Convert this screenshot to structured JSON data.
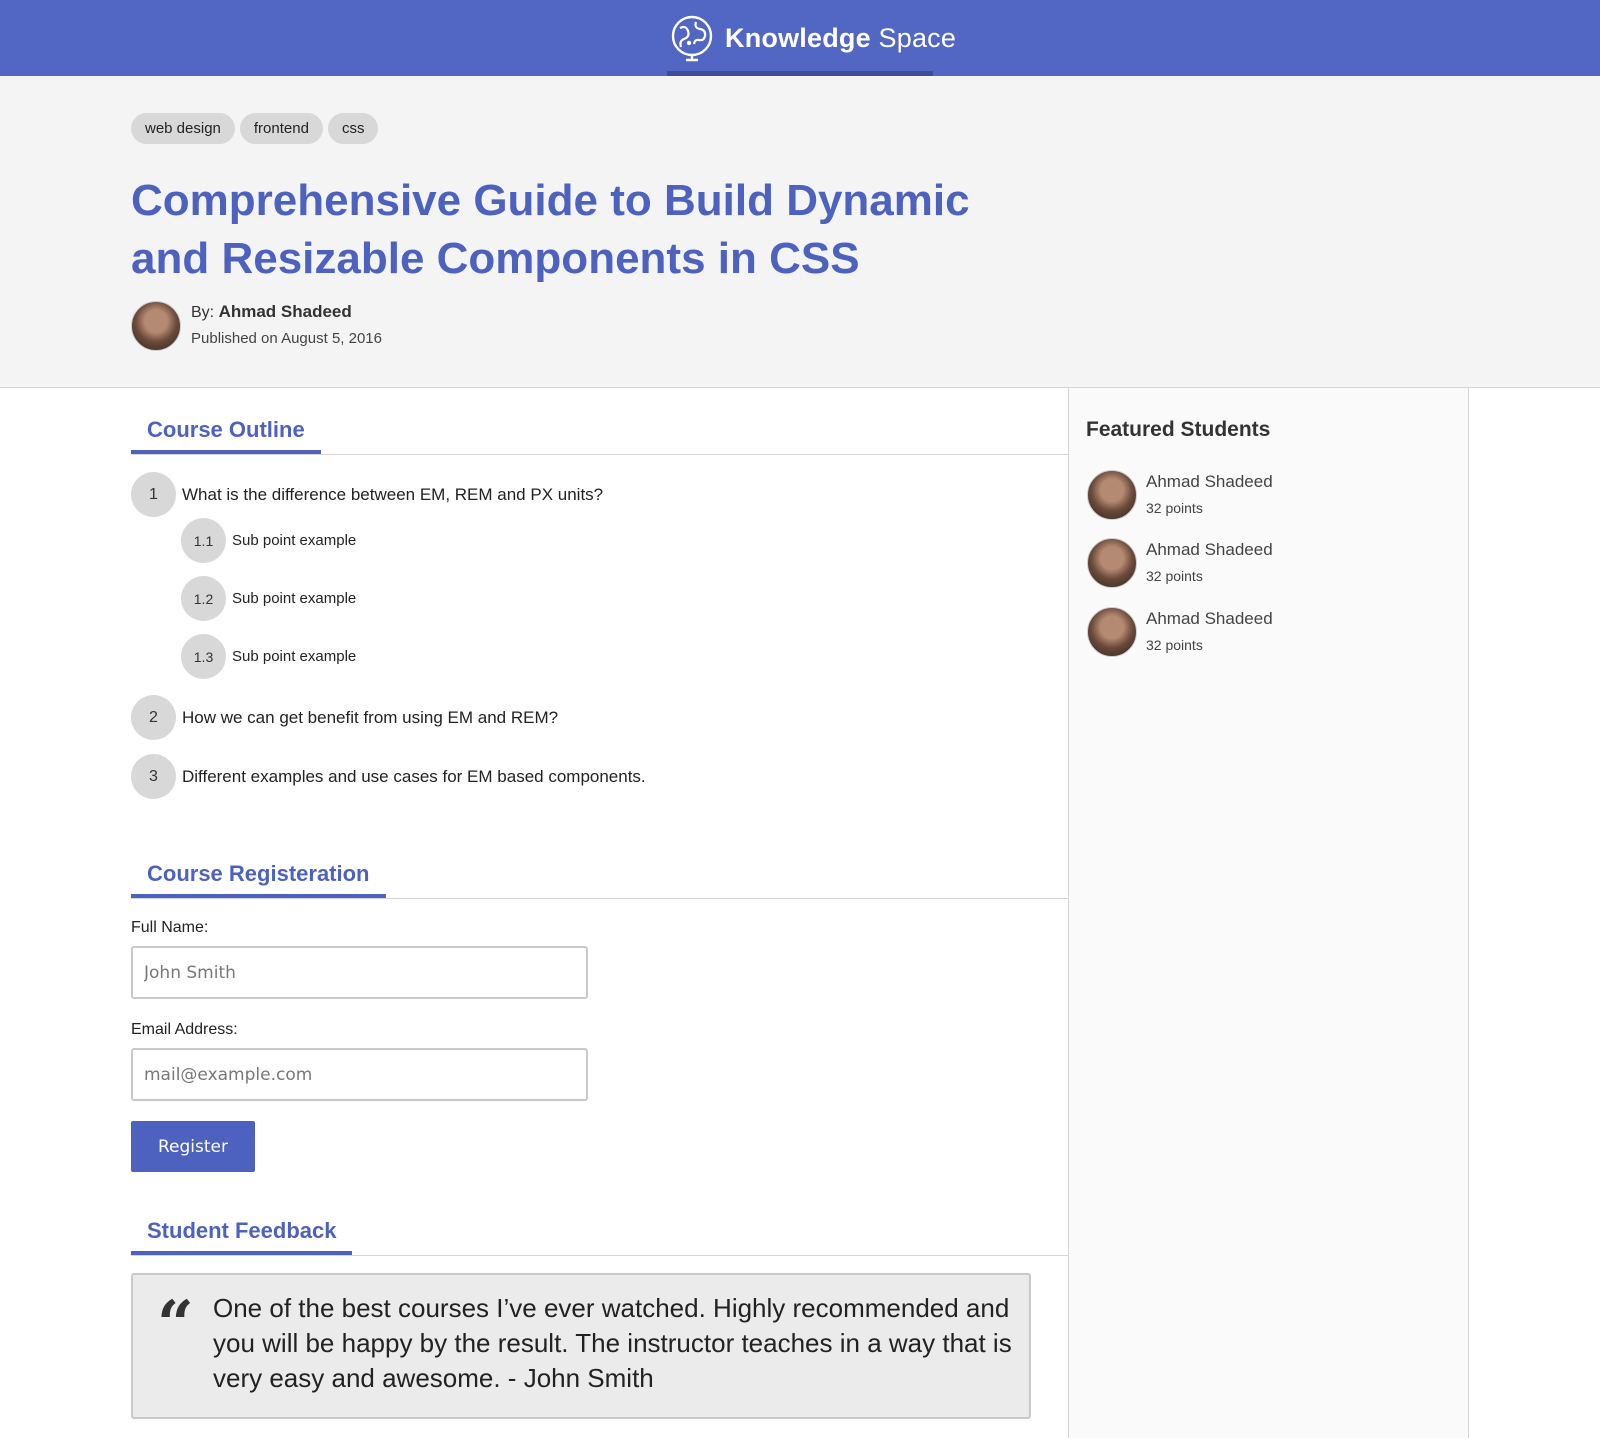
{
  "site": {
    "brand_bold": "Knowledge",
    "brand_light": " Space",
    "logo_icon": "globe-icon"
  },
  "article": {
    "tags": [
      "web design",
      "frontend",
      "css"
    ],
    "title_line1": "Comprehensive Guide to Build Dynamic",
    "title_line2": "and Resizable Components in CSS",
    "by_label": "By: ",
    "author": "Ahmad Shadeed",
    "published": "Published on August 5, 2016"
  },
  "outline": {
    "heading": "Course Outline",
    "items": [
      {
        "num": "1",
        "text": "What is the difference between EM, REM and PX units?"
      },
      {
        "num": "1.1",
        "text": "Sub point example"
      },
      {
        "num": "1.2",
        "text": "Sub point example"
      },
      {
        "num": "1.3",
        "text": "Sub point example"
      },
      {
        "num": "2",
        "text": "How we can get benefit from using EM and REM?"
      },
      {
        "num": "3",
        "text": "Different examples and use cases for EM based components."
      }
    ]
  },
  "registration": {
    "heading": "Course Registeration",
    "name_label": "Full Name:",
    "name_placeholder": "John Smith",
    "email_label": "Email Address:",
    "email_placeholder": "mail@example.com",
    "button": "Register"
  },
  "feedback": {
    "heading": "Student Feedback",
    "quote_mark": "“",
    "quote": "One of the best courses I’ve ever watched. Highly recommended and you will be happy by the result. The instructor teaches in a way that is very easy and awesome. - John Smith"
  },
  "sidebar": {
    "title": "Featured Students",
    "students": [
      {
        "name": "Ahmad Shadeed",
        "points": "32 points"
      },
      {
        "name": "Ahmad Shadeed",
        "points": "32 points"
      },
      {
        "name": "Ahmad Shadeed",
        "points": "32 points"
      }
    ]
  },
  "colors": {
    "brand": "#5266c4",
    "accent": "#4d62bf",
    "header_bg": "#f4f4f4",
    "tag_bg": "#d8d8d8"
  }
}
